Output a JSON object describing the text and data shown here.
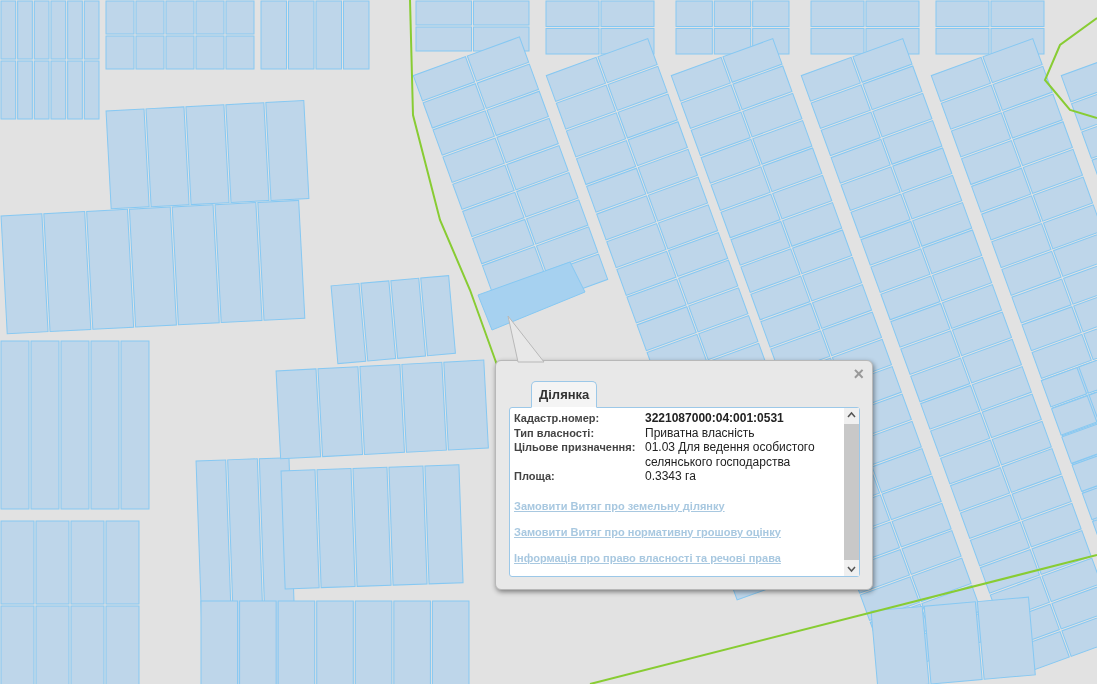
{
  "popup": {
    "tab": {
      "label": "Ділянка",
      "selected": true
    },
    "close": "×",
    "fields": [
      {
        "label": "Кадастр.номер:",
        "value": "3221087000:04:001:0531",
        "bold": true
      },
      {
        "label": "Тип власності:",
        "value": "Приватна власність",
        "bold": false
      },
      {
        "label": "Цільове призначення:",
        "value": "01.03 Для ведення особистого селянського господарства",
        "bold": false
      },
      {
        "label": "Площа:",
        "value": "0.3343 га",
        "bold": false
      }
    ],
    "links": [
      "Замовити Витяг про земельну ділянку",
      "Замовити Витяг про нормативну грошову оцінку",
      "Інформація про право власності та речові права"
    ]
  }
}
